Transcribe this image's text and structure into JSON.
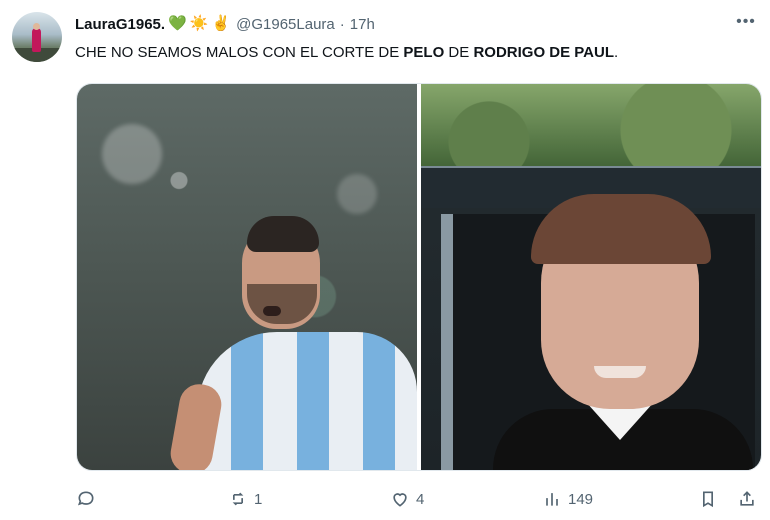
{
  "post": {
    "author": {
      "display_name": "LauraG1965.",
      "emojis": [
        "💚",
        "☀️",
        "✌️"
      ],
      "handle": "@G1965Laura",
      "separator": "·",
      "time": "17h"
    },
    "more_label": "•••",
    "text_parts": [
      "CHE NO SEAMOS MALOS CON EL CORTE DE ",
      "PELO",
      " DE ",
      "RODRIGO DE PAUL",
      "."
    ],
    "actions": {
      "reply_count": "",
      "repost_count": "1",
      "like_count": "4",
      "views_count": "149"
    }
  },
  "colors": {
    "text_primary": "#0f1419",
    "text_secondary": "#536471",
    "border": "#e1e8ed",
    "background": "#ffffff"
  },
  "icons": {
    "avatar": "avatar-image",
    "reply": "reply-icon",
    "repost": "repost-icon",
    "like": "heart-icon",
    "views": "analytics-icon",
    "bookmark": "bookmark-icon",
    "share": "share-icon",
    "more": "more-icon"
  }
}
